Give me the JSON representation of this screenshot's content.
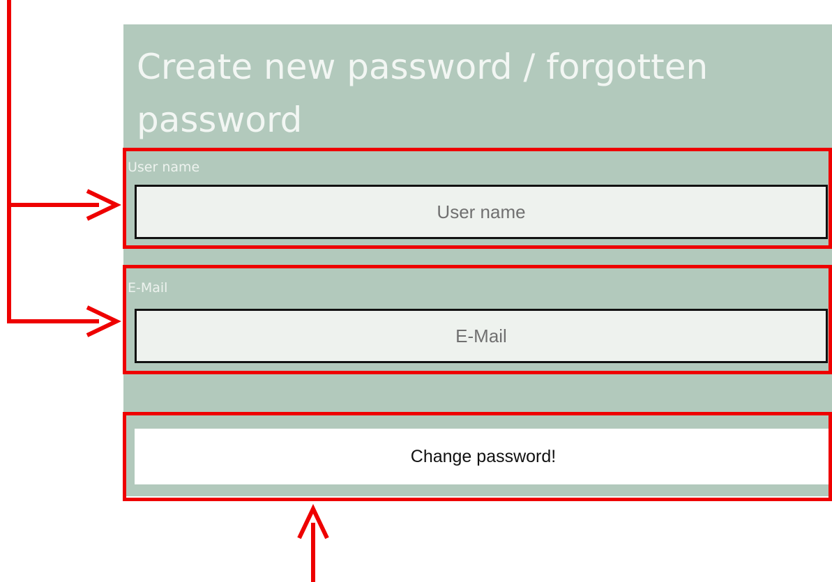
{
  "form": {
    "title": "Create new password / forgotten password",
    "username_label": "User name",
    "username_placeholder": "User name",
    "username_value": "",
    "email_label": "E-Mail",
    "email_placeholder": "E-Mail",
    "email_value": "",
    "submit_label": "Change password!"
  },
  "colors": {
    "panel_background": "#b2c9bc",
    "input_background": "#eef2ee",
    "annotation": "#ee0000"
  }
}
